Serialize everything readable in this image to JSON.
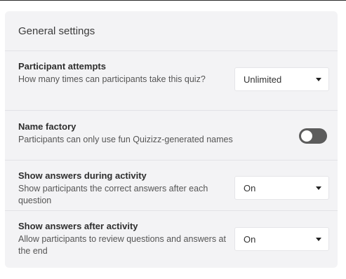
{
  "settings": {
    "header_title": "General settings",
    "rows": [
      {
        "title": "Participant attempts",
        "description": "How many times can participants take this quiz?",
        "control": "select",
        "value": "Unlimited"
      },
      {
        "title": "Name factory",
        "description": "Participants can only use fun Quizizz-generated names",
        "control": "toggle",
        "enabled": false
      },
      {
        "title": "Show answers during activity",
        "description": "Show participants the correct answers after each question",
        "control": "select",
        "value": "On"
      },
      {
        "title": "Show answers after activity",
        "description": "Allow participants to review questions and answers at the end",
        "control": "select",
        "value": "On"
      }
    ]
  },
  "colors": {
    "panel_bg": "#f3f3f5",
    "toggle_off": "#5c5c5c"
  }
}
